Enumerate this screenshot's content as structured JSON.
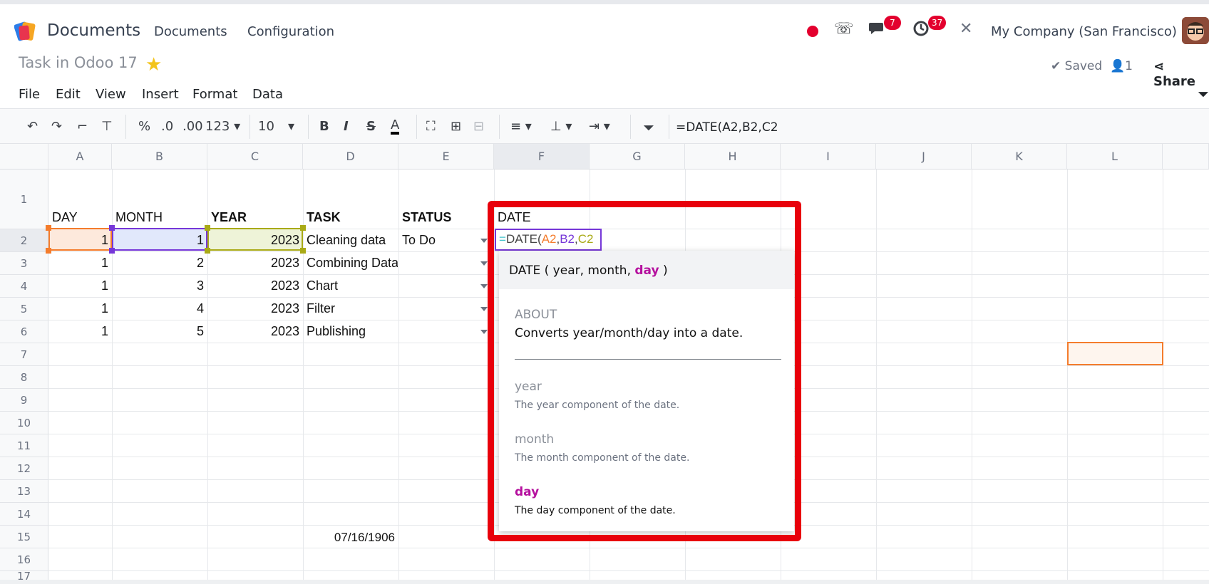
{
  "topbar": {
    "app_title": "Documents",
    "nav": [
      "Documents",
      "Configuration"
    ],
    "messages_badge": "7",
    "activities_badge": "37",
    "company": "My Company (San Francisco)"
  },
  "doc": {
    "title": "Task in Odoo 17",
    "saved_label": "Saved",
    "users_count": "1",
    "share_label": "Share"
  },
  "menu": [
    "File",
    "Edit",
    "View",
    "Insert",
    "Format",
    "Data"
  ],
  "toolbar": {
    "percent": "%",
    "decrease_decimal": ".0",
    "increase_decimal": ".00",
    "more_formats": "123",
    "font_size": "10",
    "bold": "B",
    "italic": "I",
    "strike": "S",
    "text_color": "A",
    "formula": "=DATE(A2,B2,C2"
  },
  "columns": [
    "A",
    "B",
    "C",
    "D",
    "E",
    "F",
    "G",
    "H",
    "I",
    "J",
    "K",
    "L"
  ],
  "rows": [
    "1",
    "2",
    "3",
    "4",
    "5",
    "6",
    "7",
    "8",
    "9",
    "10",
    "11",
    "12",
    "13",
    "14",
    "15",
    "16",
    "17"
  ],
  "headers": {
    "day": "DAY",
    "month": "MONTH",
    "year": "YEAR",
    "task": "TASK",
    "status": "STATUS",
    "date": "DATE"
  },
  "table": [
    {
      "day": "1",
      "month": "1",
      "year": "2023",
      "task": "Cleaning data",
      "status": "To Do"
    },
    {
      "day": "1",
      "month": "2",
      "year": "2023",
      "task": "Combining Data",
      "status": ""
    },
    {
      "day": "1",
      "month": "3",
      "year": "2023",
      "task": "Chart",
      "status": ""
    },
    {
      "day": "1",
      "month": "4",
      "year": "2023",
      "task": "Filter",
      "status": ""
    },
    {
      "day": "1",
      "month": "5",
      "year": "2023",
      "task": "Publishing",
      "status": ""
    }
  ],
  "d15_value": "07/16/1906",
  "editor": {
    "eq": "=",
    "fn": "DATE(",
    "a": "A2",
    "comma1": ",",
    "b": "B2",
    "comma2": ",",
    "c": "C2"
  },
  "popup": {
    "sig_fn": "DATE ( ",
    "sig_args": "year, month, ",
    "sig_current": "day",
    "sig_close": " )",
    "about_label": "ABOUT",
    "about_text": "Converts year/month/day into a date.",
    "args": [
      {
        "name": "year",
        "desc": "The year component of the date."
      },
      {
        "name": "month",
        "desc": "The month component of the date."
      },
      {
        "name": "day",
        "desc": "The day component of the date."
      }
    ]
  },
  "colors": {
    "accent": "#7637d8",
    "highlight_red": "#e8000b",
    "brand_orange": "#f47c2c"
  }
}
